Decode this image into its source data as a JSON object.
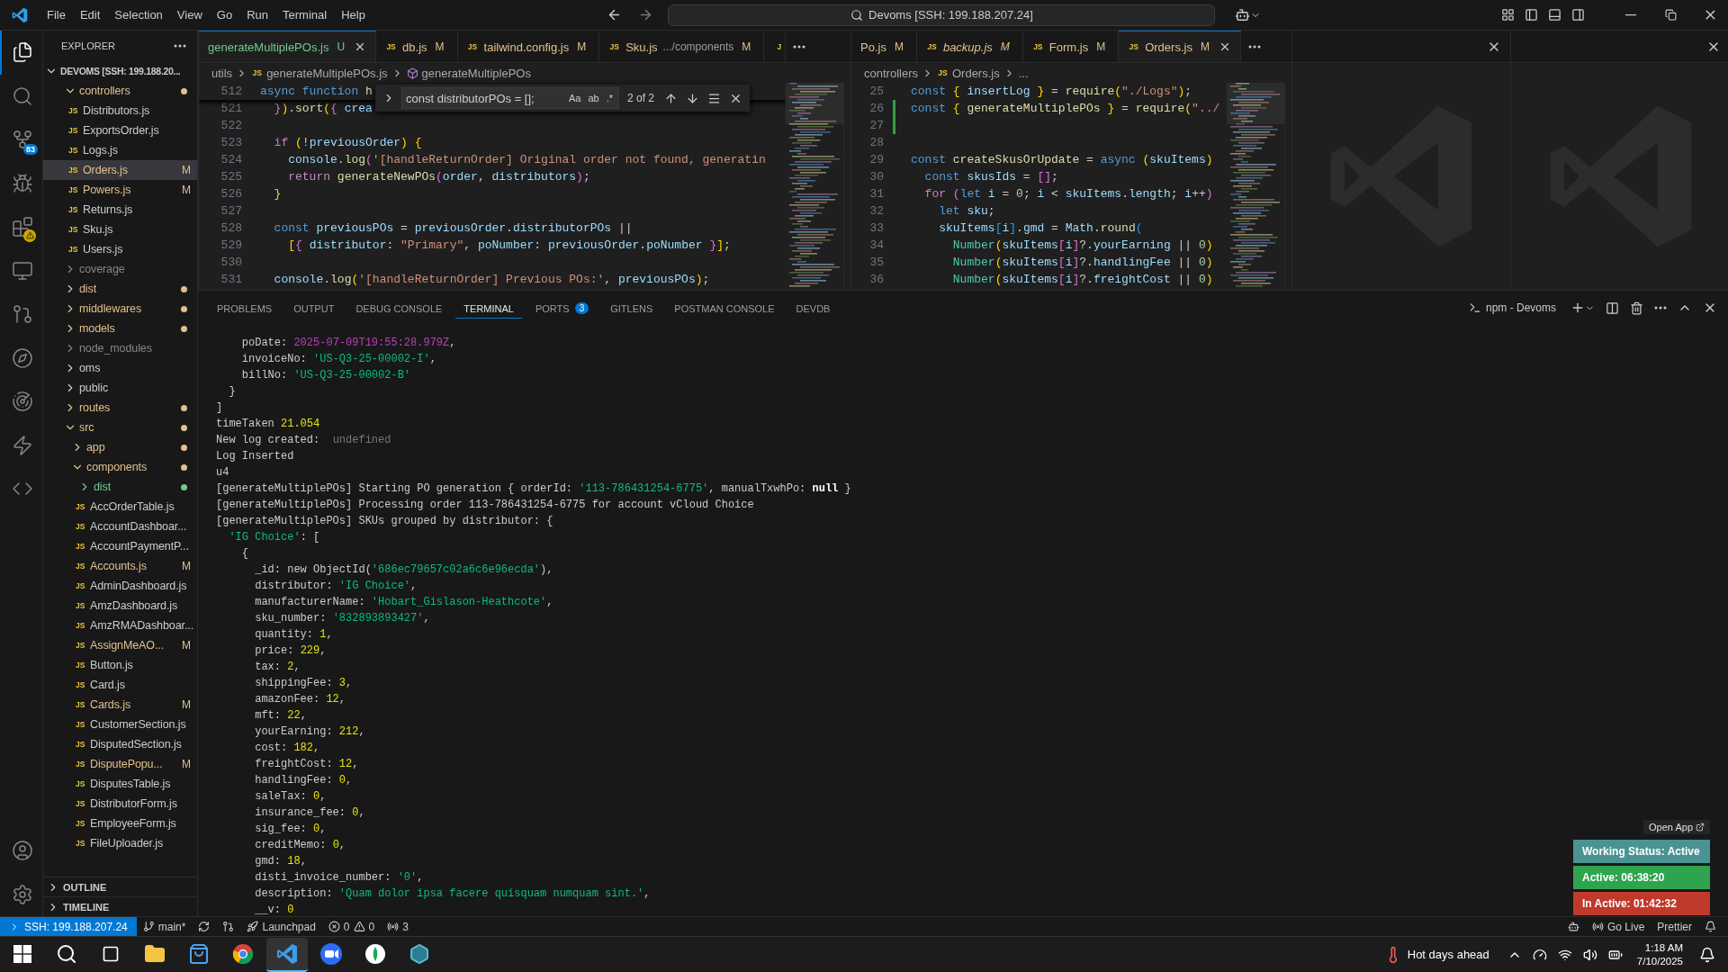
{
  "title_bar": {
    "menu": [
      "File",
      "Edit",
      "Selection",
      "View",
      "Go",
      "Run",
      "Terminal",
      "Help"
    ],
    "command_center": "Devoms [SSH: 199.188.207.24]"
  },
  "activity_bar": {
    "items": [
      {
        "selected": true,
        "warning": false
      },
      {
        "selected": false,
        "warning": false
      },
      {
        "selected": false,
        "warning": false,
        "badge": "83"
      },
      {
        "selected": false,
        "warning": false
      },
      {
        "selected": false,
        "warning": true
      },
      {
        "selected": false,
        "warning": false
      },
      {
        "selected": false,
        "warning": false
      },
      {
        "selected": false,
        "warning": false
      },
      {
        "selected": false,
        "warning": false
      },
      {
        "selected": false,
        "warning": false
      },
      {
        "selected": false,
        "warning": false
      }
    ]
  },
  "explorer": {
    "title": "EXPLORER",
    "root": {
      "label": "DEVOMS [SSH: 199.188.20...",
      "expanded": true,
      "children": [
        {
          "label": "controllers",
          "kind": "folder",
          "expanded": true,
          "modified": true,
          "untracked": false,
          "ignored": false,
          "selected": false,
          "children": [
            {
              "label": "Distributors.js",
              "kind": "file",
              "icon": "JS",
              "modified": false,
              "untracked": false,
              "ignored": false,
              "selected": false
            },
            {
              "label": "ExportsOrder.js",
              "kind": "file",
              "icon": "JS",
              "modified": false,
              "untracked": false,
              "ignored": false,
              "selected": false
            },
            {
              "label": "Logs.js",
              "kind": "file",
              "icon": "JS",
              "modified": false,
              "untracked": false,
              "ignored": false,
              "selected": false
            },
            {
              "label": "Orders.js",
              "kind": "file",
              "icon": "JS",
              "modified": true,
              "untracked": false,
              "ignored": false,
              "badge": "M",
              "selected": true
            },
            {
              "label": "Powers.js",
              "kind": "file",
              "icon": "JS",
              "modified": true,
              "untracked": false,
              "ignored": false,
              "badge": "M",
              "selected": false
            },
            {
              "label": "Returns.js",
              "kind": "file",
              "icon": "JS",
              "modified": false,
              "untracked": false,
              "ignored": false,
              "selected": false
            },
            {
              "label": "Sku.js",
              "kind": "file",
              "icon": "JS",
              "modified": false,
              "untracked": false,
              "ignored": false,
              "selected": false
            },
            {
              "label": "Users.js",
              "kind": "file",
              "icon": "JS",
              "modified": false,
              "untracked": false,
              "ignored": false,
              "selected": false
            }
          ]
        },
        {
          "label": "coverage",
          "kind": "folder",
          "expanded": false,
          "modified": false,
          "untracked": false,
          "ignored": true,
          "selected": false
        },
        {
          "label": "dist",
          "kind": "folder",
          "expanded": false,
          "modified": true,
          "untracked": false,
          "ignored": false,
          "selected": false
        },
        {
          "label": "middlewares",
          "kind": "folder",
          "expanded": false,
          "modified": true,
          "untracked": false,
          "ignored": false,
          "selected": false
        },
        {
          "label": "models",
          "kind": "folder",
          "expanded": false,
          "modified": true,
          "untracked": false,
          "ignored": false,
          "selected": false
        },
        {
          "label": "node_modules",
          "kind": "folder",
          "expanded": false,
          "modified": false,
          "untracked": false,
          "ignored": true,
          "selected": false
        },
        {
          "label": "oms",
          "kind": "folder",
          "expanded": false,
          "modified": false,
          "untracked": false,
          "ignored": false,
          "selected": false
        },
        {
          "label": "public",
          "kind": "folder",
          "expanded": false,
          "modified": false,
          "untracked": false,
          "ignored": false,
          "selected": false
        },
        {
          "label": "routes",
          "kind": "folder",
          "expanded": false,
          "modified": true,
          "untracked": false,
          "ignored": false,
          "selected": false
        },
        {
          "label": "src",
          "kind": "folder",
          "expanded": true,
          "modified": true,
          "untracked": false,
          "ignored": false,
          "selected": false,
          "children": [
            {
              "label": "app",
              "kind": "folder",
              "expanded": false,
              "modified": true,
              "untracked": false,
              "ignored": false,
              "selected": false
            },
            {
              "label": "components",
              "kind": "folder",
              "expanded": true,
              "modified": true,
              "untracked": false,
              "ignored": false,
              "selected": false,
              "children": [
                {
                  "label": "dist",
                  "kind": "folder",
                  "expanded": false,
                  "modified": false,
                  "untracked": true,
                  "ignored": false,
                  "selected": false
                },
                {
                  "label": "AccOrderTable.js",
                  "kind": "file",
                  "icon": "JS",
                  "modified": false,
                  "untracked": false,
                  "ignored": false,
                  "selected": false
                },
                {
                  "label": "AccountDashboar...",
                  "kind": "file",
                  "icon": "JS",
                  "modified": false,
                  "untracked": false,
                  "ignored": false,
                  "selected": false
                },
                {
                  "label": "AccountPaymentP...",
                  "kind": "file",
                  "icon": "JS",
                  "modified": false,
                  "untracked": false,
                  "ignored": false,
                  "selected": false
                },
                {
                  "label": "Accounts.js",
                  "kind": "file",
                  "icon": "JS",
                  "modified": true,
                  "untracked": false,
                  "ignored": false,
                  "badge": "M",
                  "selected": false
                },
                {
                  "label": "AdminDashboard.js",
                  "kind": "file",
                  "icon": "JS",
                  "modified": false,
                  "untracked": false,
                  "ignored": false,
                  "selected": false
                },
                {
                  "label": "AmzDashboard.js",
                  "kind": "file",
                  "icon": "JS",
                  "modified": false,
                  "untracked": false,
                  "ignored": false,
                  "selected": false
                },
                {
                  "label": "AmzRMADashboar...",
                  "kind": "file",
                  "icon": "JS",
                  "modified": false,
                  "untracked": false,
                  "ignored": false,
                  "selected": false
                },
                {
                  "label": "AssignMeAO...",
                  "kind": "file",
                  "icon": "JS",
                  "modified": true,
                  "untracked": false,
                  "ignored": false,
                  "badge": "M",
                  "selected": false
                },
                {
                  "label": "Button.js",
                  "kind": "file",
                  "icon": "JS",
                  "modified": false,
                  "untracked": false,
                  "ignored": false,
                  "selected": false
                },
                {
                  "label": "Card.js",
                  "kind": "file",
                  "icon": "JS",
                  "modified": false,
                  "untracked": false,
                  "ignored": false,
                  "selected": false
                },
                {
                  "label": "Cards.js",
                  "kind": "file",
                  "icon": "JS",
                  "modified": true,
                  "untracked": false,
                  "ignored": false,
                  "badge": "M",
                  "selected": false
                },
                {
                  "label": "CustomerSection.js",
                  "kind": "file",
                  "icon": "JS",
                  "modified": false,
                  "untracked": false,
                  "ignored": false,
                  "selected": false
                },
                {
                  "label": "DisputedSection.js",
                  "kind": "file",
                  "icon": "JS",
                  "modified": false,
                  "untracked": false,
                  "ignored": false,
                  "selected": false
                },
                {
                  "label": "DisputePopu...",
                  "kind": "file",
                  "icon": "JS",
                  "modified": true,
                  "untracked": false,
                  "ignored": false,
                  "badge": "M",
                  "selected": false
                },
                {
                  "label": "DisputesTable.js",
                  "kind": "file",
                  "icon": "JS",
                  "modified": false,
                  "untracked": false,
                  "ignored": false,
                  "selected": false
                },
                {
                  "label": "DistributorForm.js",
                  "kind": "file",
                  "icon": "JS",
                  "modified": false,
                  "untracked": false,
                  "ignored": false,
                  "selected": false
                },
                {
                  "label": "EmployeeForm.js",
                  "kind": "file",
                  "icon": "JS",
                  "modified": false,
                  "untracked": false,
                  "ignored": false,
                  "selected": false
                },
                {
                  "label": "FileUploader.js",
                  "kind": "file",
                  "icon": "JS",
                  "modified": false,
                  "untracked": false,
                  "ignored": false,
                  "selected": false
                }
              ]
            }
          ]
        }
      ]
    },
    "sections": [
      {
        "label": "OUTLINE",
        "expanded": false
      },
      {
        "label": "TIMELINE",
        "expanded": false
      }
    ]
  },
  "editor_groups": [
    {
      "tabs": [
        {
          "kind": "tab",
          "label": "generateMultiplePOs.js",
          "decoration": "U",
          "untracked": true,
          "selected": true,
          "preview": false
        },
        {
          "kind": "tab",
          "icon": "JS",
          "label": "db.js",
          "decoration": "M",
          "untracked": false,
          "selected": false,
          "preview": false
        },
        {
          "kind": "tab",
          "icon": "JS",
          "label": "tailwind.config.js",
          "decoration": "M",
          "untracked": false,
          "selected": false,
          "preview": false
        },
        {
          "kind": "tab",
          "icon": "JS",
          "label": "Sku.js",
          "description": ".../components",
          "decoration": "M",
          "untracked": false,
          "selected": false,
          "preview": false
        },
        {
          "kind": "clipped",
          "icon": "J",
          "selected": false,
          "preview": false
        }
      ],
      "breadcrumbs": [
        {
          "kind": "folder",
          "label": "utils"
        },
        {
          "kind": "file",
          "icon": "JS",
          "label": "generateMultiplePOs.js"
        },
        {
          "kind": "symbol",
          "label": "generateMultiplePOs"
        }
      ],
      "find": {
        "value": "const distributorPOs = [];",
        "options": [
          "Aa",
          "ab",
          ".*"
        ],
        "count": "2 of 2"
      },
      "sticky_line": {
        "number": "512",
        "tokens": [
          {
            "kind": "kw",
            "t": "async "
          },
          {
            "kind": "kw",
            "t": "function "
          },
          {
            "kind": "fn",
            "t": "h"
          }
        ]
      },
      "lines": [
        {
          "number": "521",
          "tokens": [
            {
              "kind": "b2",
              "t": "  }"
            },
            {
              "kind": "b1",
              "t": ")"
            },
            {
              "kind": "p",
              "t": "."
            },
            {
              "kind": "fn",
              "t": "sort"
            },
            {
              "kind": "b1",
              "t": "("
            },
            {
              "kind": "b2",
              "t": "{ "
            },
            {
              "kind": "var",
              "t": "crea"
            }
          ]
        },
        {
          "number": "522"
        },
        {
          "number": "523",
          "tokens": [
            {
              "kind": "ctrl",
              "t": "  if "
            },
            {
              "kind": "b1",
              "t": "("
            },
            {
              "kind": "p",
              "t": "!"
            },
            {
              "kind": "var",
              "t": "previousOrder"
            },
            {
              "kind": "b1",
              "t": ") {"
            }
          ]
        },
        {
          "number": "524",
          "tokens": [
            {
              "kind": "var",
              "t": "    console"
            },
            {
              "kind": "p",
              "t": "."
            },
            {
              "kind": "fn",
              "t": "log"
            },
            {
              "kind": "b2",
              "t": "("
            },
            {
              "kind": "str",
              "t": "'[handleReturnOrder] Original order not found, generatin"
            }
          ]
        },
        {
          "number": "525",
          "tokens": [
            {
              "kind": "ctrl",
              "t": "    return "
            },
            {
              "kind": "fn",
              "t": "generateNewPOs"
            },
            {
              "kind": "b2",
              "t": "("
            },
            {
              "kind": "var",
              "t": "order"
            },
            {
              "kind": "p",
              "t": ", "
            },
            {
              "kind": "var",
              "t": "distributors"
            },
            {
              "kind": "b2",
              "t": ")"
            },
            {
              "kind": "p",
              "t": ";"
            }
          ]
        },
        {
          "number": "526",
          "tokens": [
            {
              "kind": "b1",
              "t": "  }"
            }
          ]
        },
        {
          "number": "527"
        },
        {
          "number": "528",
          "tokens": [
            {
              "kind": "kw",
              "t": "  const "
            },
            {
              "kind": "var",
              "t": "previousPOs"
            },
            {
              "kind": "p",
              "t": " = "
            },
            {
              "kind": "var",
              "t": "previousOrder"
            },
            {
              "kind": "p",
              "t": "."
            },
            {
              "kind": "var",
              "t": "distributorPOs"
            },
            {
              "kind": "p",
              "t": " ||"
            }
          ]
        },
        {
          "number": "529",
          "tokens": [
            {
              "kind": "b1",
              "t": "    ["
            },
            {
              "kind": "b2",
              "t": "{ "
            },
            {
              "kind": "var",
              "t": "distributor"
            },
            {
              "kind": "p",
              "t": ": "
            },
            {
              "kind": "str",
              "t": "\"Primary\""
            },
            {
              "kind": "p",
              "t": ", "
            },
            {
              "kind": "var",
              "t": "poNumber"
            },
            {
              "kind": "p",
              "t": ": "
            },
            {
              "kind": "var",
              "t": "previousOrder"
            },
            {
              "kind": "p",
              "t": "."
            },
            {
              "kind": "var",
              "t": "poNumber"
            },
            {
              "kind": "b2",
              "t": " }"
            },
            {
              "kind": "b1",
              "t": "]"
            },
            {
              "kind": "p",
              "t": ";"
            }
          ]
        },
        {
          "number": "530"
        },
        {
          "number": "531",
          "tokens": [
            {
              "kind": "var",
              "t": "  console"
            },
            {
              "kind": "p",
              "t": "."
            },
            {
              "kind": "fn",
              "t": "log"
            },
            {
              "kind": "b1",
              "t": "("
            },
            {
              "kind": "str",
              "t": "'[handleReturnOrder] Previous POs:'"
            },
            {
              "kind": "p",
              "t": ", "
            },
            {
              "kind": "var",
              "t": "previousPOs"
            },
            {
              "kind": "b1",
              "t": ")"
            },
            {
              "kind": "p",
              "t": ";"
            }
          ]
        }
      ]
    },
    {
      "tabs": [
        {
          "kind": "tab",
          "label": "Po.js",
          "decoration": "M",
          "untracked": false,
          "selected": false,
          "preview": false
        },
        {
          "kind": "tab",
          "icon": "JS",
          "label": "backup.js",
          "decoration": "M",
          "untracked": false,
          "selected": false,
          "preview": true
        },
        {
          "kind": "tab",
          "icon": "JS",
          "label": "Form.js",
          "decoration": "M",
          "untracked": false,
          "selected": false,
          "preview": false
        },
        {
          "kind": "tab",
          "icon": "JS",
          "label": "Orders.js",
          "decoration": "M",
          "untracked": false,
          "selected": true,
          "preview": false
        }
      ],
      "breadcrumbs": [
        {
          "kind": "folder",
          "label": "controllers"
        },
        {
          "kind": "file",
          "icon": "JS",
          "label": "Orders.js"
        },
        {
          "kind": "more",
          "label": "..."
        }
      ],
      "lines": [
        {
          "number": "25",
          "added": false,
          "tokens": [
            {
              "kind": "kw",
              "t": "const "
            },
            {
              "kind": "b1",
              "t": "{ "
            },
            {
              "kind": "var",
              "t": "insertLog"
            },
            {
              "kind": "b1",
              "t": " }"
            },
            {
              "kind": "p",
              "t": " = "
            },
            {
              "kind": "fn",
              "t": "require"
            },
            {
              "kind": "b1",
              "t": "("
            },
            {
              "kind": "str",
              "t": "\"./Logs\""
            },
            {
              "kind": "b1",
              "t": ")"
            },
            {
              "kind": "p",
              "t": ";"
            }
          ]
        },
        {
          "number": "26",
          "added": true,
          "tokens": [
            {
              "kind": "kw",
              "t": "const "
            },
            {
              "kind": "b1",
              "t": "{ "
            },
            {
              "kind": "fn",
              "t": "generateMultiplePOs"
            },
            {
              "kind": "b1",
              "t": " }"
            },
            {
              "kind": "p",
              "t": " = "
            },
            {
              "kind": "fn",
              "t": "require"
            },
            {
              "kind": "b1",
              "t": "("
            },
            {
              "kind": "str",
              "t": "\"../"
            }
          ]
        },
        {
          "number": "27",
          "added": true
        },
        {
          "number": "28",
          "added": false
        },
        {
          "number": "29",
          "added": false,
          "tokens": [
            {
              "kind": "kw",
              "t": "const "
            },
            {
              "kind": "fn",
              "t": "createSkusOrUpdate"
            },
            {
              "kind": "p",
              "t": " = "
            },
            {
              "kind": "kw",
              "t": "async "
            },
            {
              "kind": "b1",
              "t": "("
            },
            {
              "kind": "var",
              "t": "skuItems"
            },
            {
              "kind": "b1",
              "t": ")"
            }
          ]
        },
        {
          "number": "30",
          "added": false,
          "tokens": [
            {
              "kind": "kw",
              "t": "  const "
            },
            {
              "kind": "var",
              "t": "skusIds"
            },
            {
              "kind": "p",
              "t": " = "
            },
            {
              "kind": "b2",
              "t": "[]"
            },
            {
              "kind": "p",
              "t": ";"
            }
          ]
        },
        {
          "number": "31",
          "added": false,
          "tokens": [
            {
              "kind": "ctrl",
              "t": "  for "
            },
            {
              "kind": "b2",
              "t": "("
            },
            {
              "kind": "kw",
              "t": "let "
            },
            {
              "kind": "var",
              "t": "i"
            },
            {
              "kind": "p",
              "t": " = "
            },
            {
              "kind": "num",
              "t": "0"
            },
            {
              "kind": "p",
              "t": "; "
            },
            {
              "kind": "var",
              "t": "i"
            },
            {
              "kind": "p",
              "t": " < "
            },
            {
              "kind": "var",
              "t": "skuItems"
            },
            {
              "kind": "p",
              "t": "."
            },
            {
              "kind": "var",
              "t": "length"
            },
            {
              "kind": "p",
              "t": "; "
            },
            {
              "kind": "var",
              "t": "i"
            },
            {
              "kind": "p",
              "t": "++"
            },
            {
              "kind": "b2",
              "t": ")"
            }
          ]
        },
        {
          "number": "32",
          "added": false,
          "tokens": [
            {
              "kind": "kw",
              "t": "    let "
            },
            {
              "kind": "var",
              "t": "sku"
            },
            {
              "kind": "p",
              "t": ";"
            }
          ]
        },
        {
          "number": "33",
          "added": false,
          "tokens": [
            {
              "kind": "var",
              "t": "    skuItems"
            },
            {
              "kind": "b3",
              "t": "["
            },
            {
              "kind": "var",
              "t": "i"
            },
            {
              "kind": "b3",
              "t": "]"
            },
            {
              "kind": "p",
              "t": "."
            },
            {
              "kind": "var",
              "t": "gmd"
            },
            {
              "kind": "p",
              "t": " = "
            },
            {
              "kind": "var",
              "t": "Math"
            },
            {
              "kind": "p",
              "t": "."
            },
            {
              "kind": "fn",
              "t": "round"
            },
            {
              "kind": "b3",
              "t": "("
            }
          ]
        },
        {
          "number": "34",
          "added": false,
          "tokens": [
            {
              "kind": "cls",
              "t": "      Number"
            },
            {
              "kind": "b1",
              "t": "("
            },
            {
              "kind": "var",
              "t": "skuItems"
            },
            {
              "kind": "b2",
              "t": "["
            },
            {
              "kind": "var",
              "t": "i"
            },
            {
              "kind": "b2",
              "t": "]"
            },
            {
              "kind": "p",
              "t": "?."
            },
            {
              "kind": "var",
              "t": "yourEarning"
            },
            {
              "kind": "p",
              "t": " || "
            },
            {
              "kind": "num",
              "t": "0"
            },
            {
              "kind": "b1",
              "t": ")"
            }
          ]
        },
        {
          "number": "35",
          "added": false,
          "tokens": [
            {
              "kind": "cls",
              "t": "      Number"
            },
            {
              "kind": "b1",
              "t": "("
            },
            {
              "kind": "var",
              "t": "skuItems"
            },
            {
              "kind": "b2",
              "t": "["
            },
            {
              "kind": "var",
              "t": "i"
            },
            {
              "kind": "b2",
              "t": "]"
            },
            {
              "kind": "p",
              "t": "?."
            },
            {
              "kind": "var",
              "t": "handlingFee"
            },
            {
              "kind": "p",
              "t": " || "
            },
            {
              "kind": "num",
              "t": "0"
            },
            {
              "kind": "b1",
              "t": ")"
            }
          ]
        },
        {
          "number": "36",
          "added": false,
          "tokens": [
            {
              "kind": "cls",
              "t": "      Number"
            },
            {
              "kind": "b1",
              "t": "("
            },
            {
              "kind": "var",
              "t": "skuItems"
            },
            {
              "kind": "b2",
              "t": "["
            },
            {
              "kind": "var",
              "t": "i"
            },
            {
              "kind": "b2",
              "t": "]"
            },
            {
              "kind": "p",
              "t": "?."
            },
            {
              "kind": "var",
              "t": "freightCost"
            },
            {
              "kind": "p",
              "t": " || "
            },
            {
              "kind": "num",
              "t": "0"
            },
            {
              "kind": "b1",
              "t": ")"
            }
          ]
        }
      ]
    }
  ],
  "panel": {
    "tabs": [
      {
        "label": "PROBLEMS",
        "selected": false
      },
      {
        "label": "OUTPUT",
        "selected": false
      },
      {
        "label": "DEBUG CONSOLE",
        "selected": false
      },
      {
        "label": "TERMINAL",
        "selected": true
      },
      {
        "label": "PORTS",
        "badge": "3",
        "selected": false
      },
      {
        "label": "GITLENS",
        "selected": false
      },
      {
        "label": "POSTMAN CONSOLE",
        "selected": false
      },
      {
        "label": "DEVDB",
        "selected": false
      }
    ],
    "terminal_name": "npm - Devoms",
    "lines": [
      [
        {
          "kind": "p",
          "t": "    poDate: "
        },
        {
          "kind": "date",
          "t": "2025-07-09T19:55:28.979Z"
        },
        {
          "kind": "p",
          "t": ","
        }
      ],
      [
        {
          "kind": "p",
          "t": "    invoiceNo: "
        },
        {
          "kind": "str",
          "t": "'US-Q3-25-00002-I'"
        },
        {
          "kind": "p",
          "t": ","
        }
      ],
      [
        {
          "kind": "p",
          "t": "    billNo: "
        },
        {
          "kind": "str",
          "t": "'US-Q3-25-00002-B'"
        }
      ],
      [
        {
          "kind": "p",
          "t": "  }"
        }
      ],
      [
        {
          "kind": "p",
          "t": "]"
        }
      ],
      [
        {
          "kind": "p",
          "t": "timeTaken "
        },
        {
          "kind": "num",
          "t": "21.054"
        }
      ],
      [
        {
          "kind": "p",
          "t": "New log created:  "
        },
        {
          "kind": "dim",
          "t": "undefined"
        }
      ],
      [
        {
          "kind": "p",
          "t": "Log Inserted"
        }
      ],
      [
        {
          "kind": "p",
          "t": "u4"
        }
      ],
      [
        {
          "kind": "p",
          "t": "[generateMultiplePOs] Starting PO generation { orderId: "
        },
        {
          "kind": "str",
          "t": "'113-786431254-6775'"
        },
        {
          "kind": "p",
          "t": ", manualTxwhPo: "
        },
        {
          "kind": "bold",
          "t": "null"
        },
        {
          "kind": "p",
          "t": " }"
        }
      ],
      [
        {
          "kind": "p",
          "t": "[generateMultiplePOs] Processing order 113-786431254-6775 for account vCloud Choice"
        }
      ],
      [
        {
          "kind": "p",
          "t": "[generateMultiplePOs] SKUs grouped by distributor: {"
        }
      ],
      [
        {
          "kind": "str",
          "t": "  'IG Choice'"
        },
        {
          "kind": "p",
          "t": ": ["
        }
      ],
      [
        {
          "kind": "p",
          "t": "    {"
        }
      ],
      [
        {
          "kind": "p",
          "t": "      _id: new ObjectId("
        },
        {
          "kind": "str",
          "t": "'686ec79657c02a6c6e96ecda'"
        },
        {
          "kind": "p",
          "t": "),"
        }
      ],
      [
        {
          "kind": "p",
          "t": "      distributor: "
        },
        {
          "kind": "str",
          "t": "'IG Choice'"
        },
        {
          "kind": "p",
          "t": ","
        }
      ],
      [
        {
          "kind": "p",
          "t": "      manufacturerName: "
        },
        {
          "kind": "str",
          "t": "'Hobart_Gislason-Heathcote'"
        },
        {
          "kind": "p",
          "t": ","
        }
      ],
      [
        {
          "kind": "p",
          "t": "      sku_number: "
        },
        {
          "kind": "str",
          "t": "'832893893427'"
        },
        {
          "kind": "p",
          "t": ","
        }
      ],
      [
        {
          "kind": "p",
          "t": "      quantity: "
        },
        {
          "kind": "num",
          "t": "1"
        },
        {
          "kind": "p",
          "t": ","
        }
      ],
      [
        {
          "kind": "p",
          "t": "      price: "
        },
        {
          "kind": "num",
          "t": "229"
        },
        {
          "kind": "p",
          "t": ","
        }
      ],
      [
        {
          "kind": "p",
          "t": "      tax: "
        },
        {
          "kind": "num",
          "t": "2"
        },
        {
          "kind": "p",
          "t": ","
        }
      ],
      [
        {
          "kind": "p",
          "t": "      shippingFee: "
        },
        {
          "kind": "num",
          "t": "3"
        },
        {
          "kind": "p",
          "t": ","
        }
      ],
      [
        {
          "kind": "p",
          "t": "      amazonFee: "
        },
        {
          "kind": "num",
          "t": "12"
        },
        {
          "kind": "p",
          "t": ","
        }
      ],
      [
        {
          "kind": "p",
          "t": "      mft: "
        },
        {
          "kind": "num",
          "t": "22"
        },
        {
          "kind": "p",
          "t": ","
        }
      ],
      [
        {
          "kind": "p",
          "t": "      yourEarning: "
        },
        {
          "kind": "num",
          "t": "212"
        },
        {
          "kind": "p",
          "t": ","
        }
      ],
      [
        {
          "kind": "p",
          "t": "      cost: "
        },
        {
          "kind": "num",
          "t": "182"
        },
        {
          "kind": "p",
          "t": ","
        }
      ],
      [
        {
          "kind": "p",
          "t": "      freightCost: "
        },
        {
          "kind": "num",
          "t": "12"
        },
        {
          "kind": "p",
          "t": ","
        }
      ],
      [
        {
          "kind": "p",
          "t": "      handlingFee: "
        },
        {
          "kind": "num",
          "t": "0"
        },
        {
          "kind": "p",
          "t": ","
        }
      ],
      [
        {
          "kind": "p",
          "t": "      saleTax: "
        },
        {
          "kind": "num",
          "t": "0"
        },
        {
          "kind": "p",
          "t": ","
        }
      ],
      [
        {
          "kind": "p",
          "t": "      insurance_fee: "
        },
        {
          "kind": "num",
          "t": "0"
        },
        {
          "kind": "p",
          "t": ","
        }
      ],
      [
        {
          "kind": "p",
          "t": "      sig_fee: "
        },
        {
          "kind": "num",
          "t": "0"
        },
        {
          "kind": "p",
          "t": ","
        }
      ],
      [
        {
          "kind": "p",
          "t": "      creditMemo: "
        },
        {
          "kind": "num",
          "t": "0"
        },
        {
          "kind": "p",
          "t": ","
        }
      ],
      [
        {
          "kind": "p",
          "t": "      gmd: "
        },
        {
          "kind": "num",
          "t": "18"
        },
        {
          "kind": "p",
          "t": ","
        }
      ],
      [
        {
          "kind": "p",
          "t": "      disti_invoice_number: "
        },
        {
          "kind": "str",
          "t": "'0'"
        },
        {
          "kind": "p",
          "t": ","
        }
      ],
      [
        {
          "kind": "p",
          "t": "      description: "
        },
        {
          "kind": "str",
          "t": "'Quam dolor ipsa facere quisquam numquam sint.'"
        },
        {
          "kind": "p",
          "t": ","
        }
      ],
      [
        {
          "kind": "p",
          "t": "      __v: "
        },
        {
          "kind": "num",
          "t": "0"
        }
      ]
    ]
  },
  "tracker": {
    "open_app": "Open App",
    "items": [
      {
        "label": "Working Status: Active",
        "color": "#4b9393"
      },
      {
        "label": "Active: 06:38:20",
        "color": "#2ea44f"
      },
      {
        "label": "In Active: 01:42:32",
        "color": "#c0392b"
      }
    ]
  },
  "status_bar": {
    "remote": "SSH: 199.188.207.24",
    "branch": "main*",
    "launchpad": "Launchpad",
    "errors": "0",
    "warnings": "0",
    "ports": "3",
    "right": [
      "Go Live",
      "Prettier"
    ]
  },
  "taskbar": {
    "apps": [
      {
        "selected": false
      },
      {
        "selected": false
      },
      {
        "selected": false
      },
      {
        "selected": true
      },
      {
        "selected": false
      },
      {
        "selected": false
      },
      {
        "selected": false
      }
    ],
    "weather": "Hot days ahead",
    "time": "1:18 AM",
    "date": "7/10/2025"
  }
}
